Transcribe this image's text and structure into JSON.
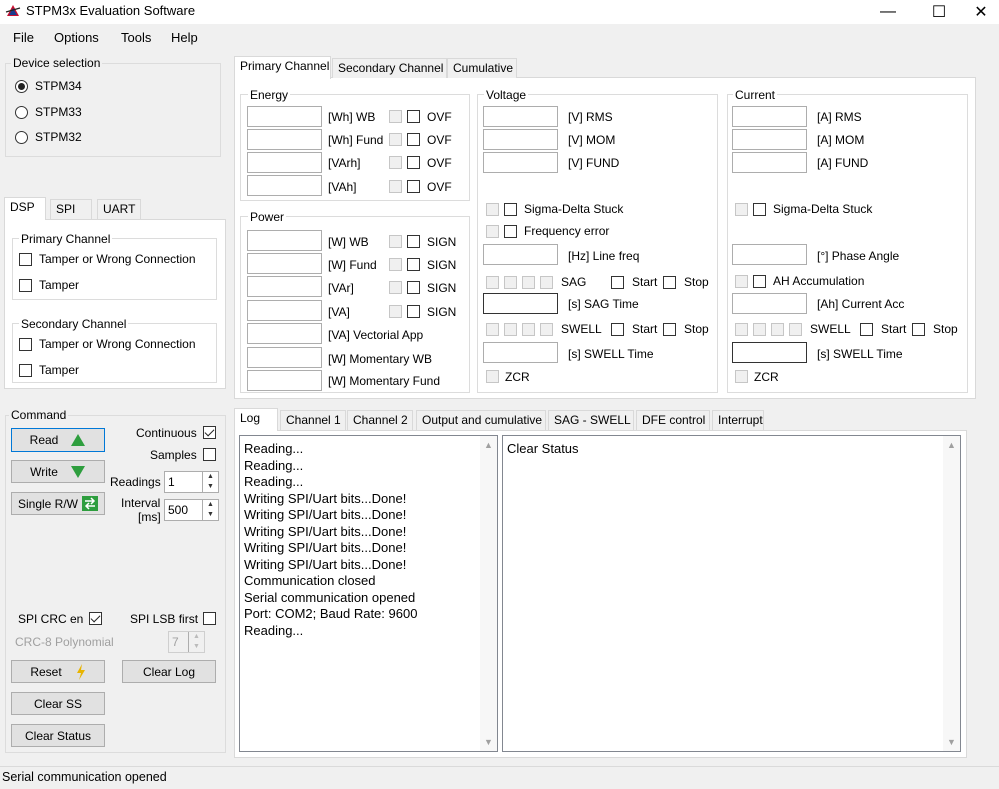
{
  "window": {
    "title": "STPM3x Evaluation Software",
    "minimize": "—",
    "maximize": "☐",
    "close": "✕"
  },
  "menu": [
    "File",
    "Options",
    "Tools",
    "Help"
  ],
  "device_selection": {
    "title": "Device selection",
    "options": [
      "STPM34",
      "STPM33",
      "STPM32"
    ],
    "selected": "STPM34"
  },
  "left_tabs": [
    "DSP",
    "SPI",
    "UART"
  ],
  "dsp": {
    "primary_title": "Primary Channel",
    "primary_items": [
      "Tamper or Wrong Connection",
      "Tamper"
    ],
    "secondary_title": "Secondary Channel",
    "secondary_items": [
      "Tamper or Wrong Connection",
      "Tamper"
    ]
  },
  "command": {
    "title": "Command",
    "read": "Read",
    "write": "Write",
    "single_rw": "Single R/W",
    "continuous": "Continuous",
    "samples": "Samples",
    "readings_label": "Readings",
    "readings_value": "1",
    "interval_label_1": "Interval",
    "interval_label_2": "[ms]",
    "interval_value": "500",
    "spi_crc_en": "SPI CRC en",
    "spi_lsb_first": "SPI LSB first",
    "crc_poly_label": "CRC-8 Polynomial",
    "crc_poly_value": "7",
    "reset": "Reset",
    "clear_log": "Clear Log",
    "clear_ss": "Clear SS",
    "clear_status": "Clear Status"
  },
  "top_tabs": [
    "Primary Channel",
    "Secondary Channel",
    "Cumulative"
  ],
  "energy": {
    "title": "Energy",
    "rows": [
      "[Wh] WB",
      "[Wh] Fund",
      "[VArh]",
      "[VAh]"
    ],
    "flag": "OVF"
  },
  "power": {
    "title": "Power",
    "rows": [
      "[W] WB",
      "[W] Fund",
      "[VAr]",
      "[VA]",
      "[VA] Vectorial App",
      "[W] Momentary WB",
      "[W] Momentary Fund"
    ],
    "flag": "SIGN"
  },
  "voltage": {
    "title": "Voltage",
    "rows": [
      "[V] RMS",
      "[V] MOM",
      "[V] FUND"
    ],
    "sigma": "Sigma-Delta Stuck",
    "freq_err": "Frequency error",
    "line_freq": "[Hz] Line freq",
    "sag": "SAG",
    "start": "Start",
    "stop": "Stop",
    "sag_time": "[s] SAG Time",
    "swell": "SWELL",
    "swell_time": "[s] SWELL Time",
    "zcr": "ZCR"
  },
  "current": {
    "title": "Current",
    "rows": [
      "[A] RMS",
      "[A] MOM",
      "[A] FUND"
    ],
    "sigma": "Sigma-Delta Stuck",
    "phase": "[°] Phase Angle",
    "ah_acc": "AH Accumulation",
    "current_acc": "[Ah] Current Acc",
    "swell": "SWELL",
    "start": "Start",
    "stop": "Stop",
    "swell_time": "[s] SWELL Time",
    "zcr": "ZCR"
  },
  "bottom_tabs": [
    "Log",
    "Channel 1",
    "Channel 2",
    "Output and cumulative",
    "SAG - SWELL",
    "DFE control",
    "Interrupt"
  ],
  "log_lines": [
    "Reading...",
    "Reading...",
    "Reading...",
    "Writing SPI/Uart bits...Done!",
    "Writing SPI/Uart bits...Done!",
    "Writing SPI/Uart bits...Done!",
    "Writing SPI/Uart bits...Done!",
    "Writing SPI/Uart bits...Done!",
    "Communication closed",
    "Serial communication opened",
    "Port: COM2; Baud Rate: 9600",
    "Reading..."
  ],
  "status_panel": "Clear Status",
  "status_bar": "Serial communication opened"
}
